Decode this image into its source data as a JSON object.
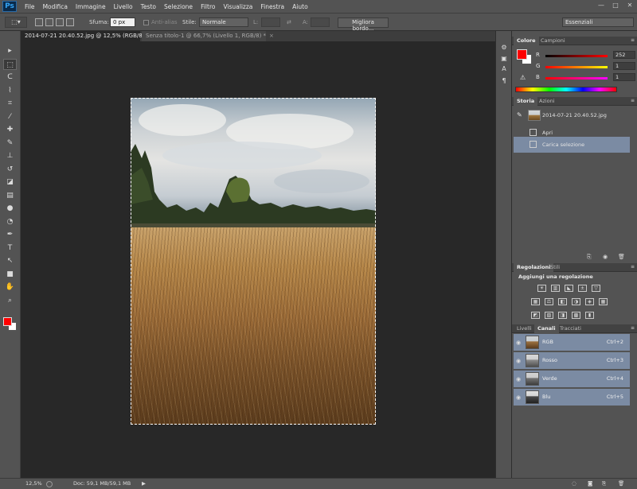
{
  "app": {
    "logo": "Ps"
  },
  "menu": [
    "File",
    "Modifica",
    "Immagine",
    "Livello",
    "Testo",
    "Selezione",
    "Filtro",
    "Visualizza",
    "Finestra",
    "Aiuto"
  ],
  "window_controls": [
    "—",
    "□",
    "✕"
  ],
  "options_bar": {
    "feather_label": "Sfuma:",
    "feather_value": "0 px",
    "antialias_label": "Anti-alias",
    "style_label": "Stile:",
    "style_value": "Normale",
    "width_label": "L:",
    "height_label": "A:",
    "refine_edge": "Migliora bordo...",
    "workspace": "Essenziali"
  },
  "tabs": [
    {
      "label": "2014-07-21 20.40.52.jpg @ 12,5% (RGB/8)",
      "active": true
    },
    {
      "label": "Senza titolo-1 @ 66,7% (Livello 1, RGB/8) *",
      "active": false
    }
  ],
  "tools": [
    {
      "name": "move-tool",
      "glyph": "▸"
    },
    {
      "name": "marquee-tool",
      "glyph": "⬚",
      "active": true
    },
    {
      "name": "lasso-tool",
      "glyph": "ᑕ"
    },
    {
      "name": "quick-selection-tool",
      "glyph": "⌇"
    },
    {
      "name": "crop-tool",
      "glyph": "⌗"
    },
    {
      "name": "eyedropper-tool",
      "glyph": "⁄"
    },
    {
      "name": "healing-brush-tool",
      "glyph": "✚"
    },
    {
      "name": "brush-tool",
      "glyph": "✎"
    },
    {
      "name": "clone-stamp-tool",
      "glyph": "⊥"
    },
    {
      "name": "history-brush-tool",
      "glyph": "↺"
    },
    {
      "name": "eraser-tool",
      "glyph": "◪"
    },
    {
      "name": "gradient-tool",
      "glyph": "▤"
    },
    {
      "name": "blur-tool",
      "glyph": "●"
    },
    {
      "name": "dodge-tool",
      "glyph": "◔"
    },
    {
      "name": "pen-tool",
      "glyph": "✒"
    },
    {
      "name": "type-tool",
      "glyph": "T"
    },
    {
      "name": "path-selection-tool",
      "glyph": "↖"
    },
    {
      "name": "rectangle-tool",
      "glyph": "■"
    },
    {
      "name": "hand-tool",
      "glyph": "✋"
    },
    {
      "name": "zoom-tool",
      "glyph": "⌕"
    }
  ],
  "color_panel": {
    "tabs": [
      "Colore",
      "Campioni"
    ],
    "sliders": [
      {
        "label": "R",
        "value": "252",
        "track": "linear-gradient(90deg,#000,#ff0000)"
      },
      {
        "label": "G",
        "value": "1",
        "track": "linear-gradient(90deg,#fc0000,#fcff00)"
      },
      {
        "label": "B",
        "value": "1",
        "track": "linear-gradient(90deg,#fc0000,#fc00ff)"
      }
    ],
    "foreground": "#fc0101"
  },
  "history_panel": {
    "tabs": [
      "Storia",
      "Azioni"
    ],
    "snapshot": "2014-07-21 20.40.52.jpg",
    "items": [
      "Apri",
      "Carica selezione"
    ]
  },
  "adjustments_panel": {
    "tabs": [
      "Regolazioni",
      "Stili"
    ],
    "title": "Aggiungi una regolazione"
  },
  "layers_panel": {
    "tabs": [
      "Livelli",
      "Canali",
      "Tracciati"
    ],
    "channels": [
      {
        "name": "RGB",
        "shortcut": "Ctrl+2"
      },
      {
        "name": "Rosso",
        "shortcut": "Ctrl+3"
      },
      {
        "name": "Verde",
        "shortcut": "Ctrl+4"
      },
      {
        "name": "Blu",
        "shortcut": "Ctrl+5"
      }
    ]
  },
  "status": {
    "zoom": "12,5%",
    "doc": "Doc: 59,1 MB/59,1 MB"
  }
}
